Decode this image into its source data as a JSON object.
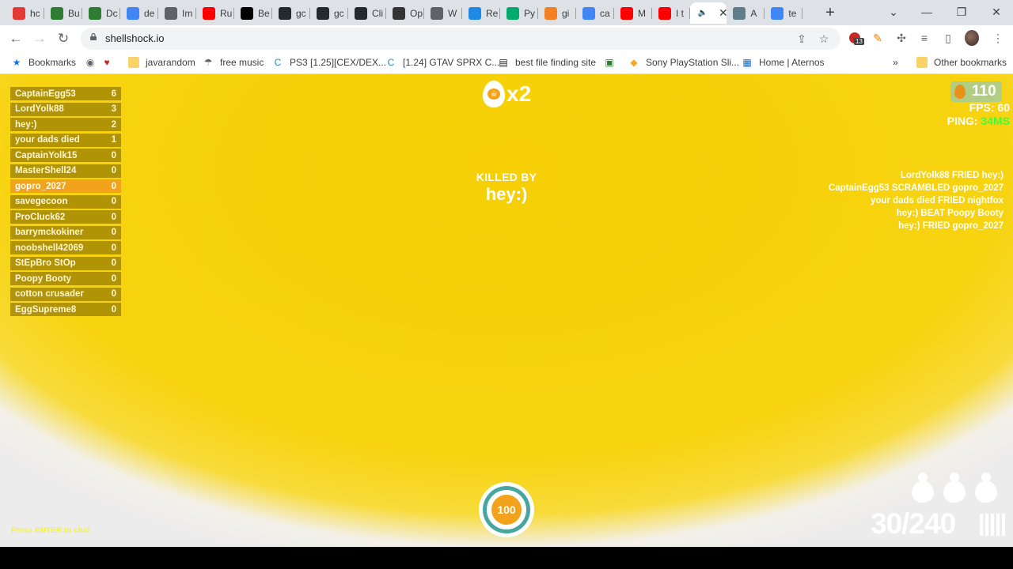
{
  "browser": {
    "tabs": [
      {
        "label": "hc",
        "icon": "colorful-logo",
        "color": "#e53935"
      },
      {
        "label": "Bu",
        "icon": "green-square",
        "color": "#2e7d32"
      },
      {
        "label": "Dc",
        "icon": "green-square",
        "color": "#2e7d32"
      },
      {
        "label": "de",
        "icon": "google-g",
        "color": "#4285f4"
      },
      {
        "label": "Im",
        "icon": "chart-line",
        "color": "#5f6368"
      },
      {
        "label": "Ru",
        "icon": "youtube",
        "color": "#ff0000"
      },
      {
        "label": "Be",
        "icon": "m-logo",
        "color": "#000000"
      },
      {
        "label": "gc",
        "icon": "github",
        "color": "#24292e"
      },
      {
        "label": "gc",
        "icon": "github",
        "color": "#24292e"
      },
      {
        "label": "Cli",
        "icon": "github",
        "color": "#24292e"
      },
      {
        "label": "Op",
        "icon": "dark-globe",
        "color": "#333333"
      },
      {
        "label": "W",
        "icon": "globe",
        "color": "#5f6368"
      },
      {
        "label": "Re",
        "icon": "circle-dot",
        "color": "#1e88e5"
      },
      {
        "label": "Py",
        "icon": "w3-logo",
        "color": "#04aa6d"
      },
      {
        "label": "gi",
        "icon": "stack-icon",
        "color": "#f48024"
      },
      {
        "label": "ca",
        "icon": "google-g",
        "color": "#4285f4"
      },
      {
        "label": "M",
        "icon": "youtube",
        "color": "#ff0000"
      },
      {
        "label": "I t",
        "icon": "youtube",
        "color": "#ff0000"
      },
      {
        "label": "",
        "icon": "speaker",
        "color": "#3c4043",
        "active": true
      },
      {
        "label": "A",
        "icon": "image-thumb",
        "color": "#607d8b"
      },
      {
        "label": "te",
        "icon": "google-g",
        "color": "#4285f4"
      }
    ],
    "url": "shellshock.io",
    "bookmarks": [
      {
        "label": "Bookmarks",
        "icon": "star-icon"
      },
      {
        "label": "",
        "icon": "globe-icon"
      },
      {
        "label": "",
        "icon": "heart-icon"
      },
      {
        "label": "javarandom",
        "icon": "folder-icon"
      },
      {
        "label": "free music",
        "icon": "ufo-icon"
      },
      {
        "label": "PS3 [1.25][CEX/DEX...",
        "icon": "c-logo-icon"
      },
      {
        "label": "[1.24] GTAV SPRX C...",
        "icon": "c-logo-icon"
      },
      {
        "label": "best file finding site",
        "icon": "printer-icon"
      },
      {
        "label": "",
        "icon": "green-box-icon"
      },
      {
        "label": "Sony PlayStation Sli...",
        "icon": "bag-icon"
      },
      {
        "label": "Home | Aternos",
        "icon": "grid-icon"
      }
    ],
    "other_bookmarks": "Other bookmarks",
    "overflow": "»",
    "extension_badge": "13"
  },
  "game": {
    "leaderboard": [
      {
        "name": "CaptainEgg53",
        "score": "6"
      },
      {
        "name": "LordYolk88",
        "score": "3"
      },
      {
        "name": "hey:)",
        "score": "2"
      },
      {
        "name": "your dads died",
        "score": "1"
      },
      {
        "name": "CaptainYolk15",
        "score": "0"
      },
      {
        "name": "MasterShell24",
        "score": "0"
      },
      {
        "name": "gopro_2027",
        "score": "0",
        "me": true
      },
      {
        "name": "savegecoon",
        "score": "0"
      },
      {
        "name": "ProCluck62",
        "score": "0"
      },
      {
        "name": "barrymckokiner",
        "score": "0"
      },
      {
        "name": "noobshell42069",
        "score": "0"
      },
      {
        "name": "StEpBro StOp",
        "score": "0"
      },
      {
        "name": "Poopy Booty",
        "score": "0"
      },
      {
        "name": "cotton crusader",
        "score": "0"
      },
      {
        "name": "EggSupreme8",
        "score": "0"
      }
    ],
    "kill_multiplier": "x2",
    "killed_by_label": "KILLED BY",
    "killed_by_name": "hey:)",
    "eggs": "110",
    "fps_label": "FPS:",
    "fps_value": "60",
    "ping_label": "PING:",
    "ping_value": "34MS",
    "ping_color": "#3dff3d",
    "kill_feed": [
      "LordYolk88 FRIED hey:)",
      "CaptainEgg53 SCRAMBLED gopro_2027",
      "your dads died FRIED nightfox",
      "hey:) BEAT Poopy Booty",
      "hey:) FRIED gopro_2027"
    ],
    "health": "100",
    "ammo": "30/240",
    "grenade_count": 3,
    "chat_prompt": "Press ENTER to chat"
  }
}
